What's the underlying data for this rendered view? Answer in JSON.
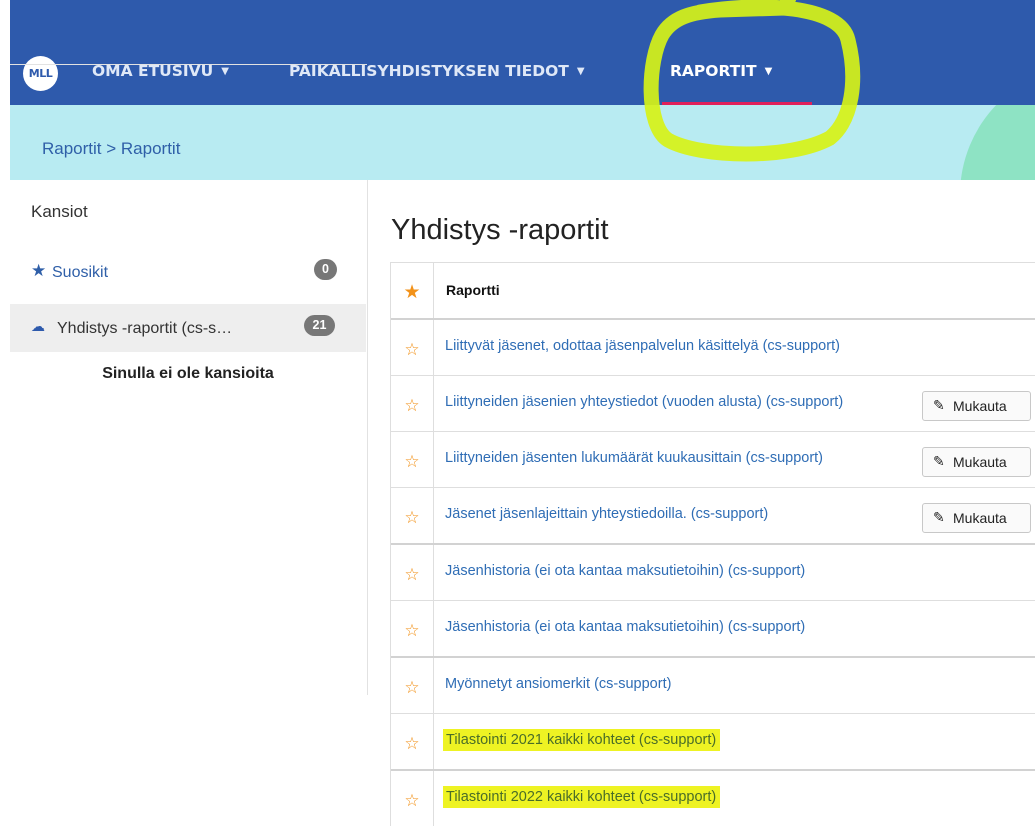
{
  "nav": {
    "logo": "MLL",
    "items": [
      {
        "label": "OMA ETUSIVU",
        "caret": "▼"
      },
      {
        "label": "PAIKALLISYHDISTYKSEN TIEDOT",
        "caret": "▼"
      },
      {
        "label": "RAPORTIT",
        "caret": "▼"
      }
    ]
  },
  "breadcrumb": "Raportit > Raportit",
  "sidebar": {
    "heading": "Kansiot",
    "favorites": {
      "label": "Suosikit",
      "count": "0",
      "icon": "star-icon"
    },
    "folder": {
      "label": "Yhdistys -raportit (cs-s…",
      "count": "21",
      "icon": "cloud-icon"
    },
    "empty_text": "Sinulla ei ole kansioita"
  },
  "main": {
    "title": "Yhdistys -raportit",
    "table_header": "Raportti",
    "customize_label": "Mukauta",
    "reports": [
      {
        "label": "Liittyvät jäsenet, odottaa jäsenpalvelun käsittelyä (cs-support)"
      },
      {
        "label": "Liittyneiden jäsenien yhteystiedot (vuoden alusta) (cs-support)"
      },
      {
        "label": "Liittyneiden jäsenten lukumäärät kuukausittain (cs-support)"
      },
      {
        "label": "Jäsenet jäsenlajeittain yhteystiedoilla. (cs-support)"
      },
      {
        "label": "Jäsenhistoria (ei ota kantaa maksutietoihin) (cs-support)"
      },
      {
        "label": "Jäsenhistoria (ei ota kantaa maksutietoihin) (cs-support)"
      },
      {
        "label": "Myönnetyt ansiomerkit (cs-support)"
      },
      {
        "label": "Tilastointi 2021 kaikki kohteet (cs-support)"
      },
      {
        "label": "Tilastointi 2022 kaikki kohteet (cs-support)"
      }
    ]
  },
  "colors": {
    "nav_bg": "#2e5aac",
    "breadcrumb_bg": "#b8ebf2",
    "link": "#2f6db5",
    "star": "#f2921a",
    "highlight": "#eef323",
    "active_underline": "#e0205a"
  }
}
